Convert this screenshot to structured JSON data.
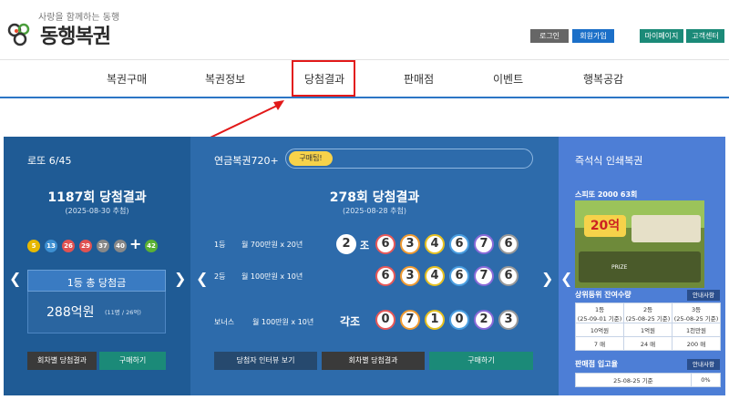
{
  "logo": {
    "slogan": "사랑을 함께하는 동행",
    "name": "동행복권"
  },
  "topbar": {
    "login": "로그인",
    "signup": "회원가입",
    "mypage": "마이페이지",
    "support": "고객센터"
  },
  "nav": [
    "복권구매",
    "복권정보",
    "당첨결과",
    "판매점",
    "이벤트",
    "행복공감"
  ],
  "lotto": {
    "title": "로또 6/45",
    "round": "1187회 당첨결과",
    "date": "(2025-08-30 추첨)",
    "numbers": [
      "5",
      "13",
      "26",
      "29",
      "37",
      "40"
    ],
    "bonus": "42",
    "plus": "+",
    "prize_label": "1등 총 당첨금",
    "prize_amount": "288억원",
    "prize_sub": "(11명 / 26억)",
    "btn_results": "회차별 당첨결과",
    "btn_buy": "구매하기"
  },
  "pension": {
    "title": "연금복권720+",
    "tip": "구매팁!",
    "round": "278회 당첨결과",
    "date": "(2025-08-28 추첨)",
    "row1_label": "1등",
    "row1_desc": "월 700만원 x 20년",
    "row1_group": "2",
    "row1_jo": "조",
    "row1_numbers": [
      "6",
      "3",
      "4",
      "6",
      "7",
      "6"
    ],
    "row2_label": "2등",
    "row2_desc": "월 100만원 x 10년",
    "row2_numbers": [
      "6",
      "3",
      "4",
      "6",
      "7",
      "6"
    ],
    "row3_label": "보너스",
    "row3_desc": "월 100만원 x 10년",
    "row3_group": "각조",
    "row3_numbers": [
      "0",
      "7",
      "1",
      "0",
      "2",
      "3"
    ],
    "btn_interview": "당첨자 인터뷰 보기",
    "btn_results": "회차별 당첨결과",
    "btn_buy": "구매하기"
  },
  "instant": {
    "title": "즉석식 인쇄복권",
    "product": "스피또 2000 63회",
    "card_amount": "20억",
    "card_prize": "PRIZE",
    "table_title": "상위등위 잔여수량",
    "guide": "안내사항",
    "headers": [
      "1등\n(25-09-01 기준)",
      "2등\n(25-08-25 기준)",
      "3등\n(25-08-25 기준)"
    ],
    "amounts": [
      "10억원",
      "1억원",
      "1천만원"
    ],
    "counts": [
      "7 매",
      "24 매",
      "200 매"
    ],
    "stock_title": "판매점 입고율",
    "stock_date": "25-08-25 기준",
    "stock_value": "0%"
  },
  "colors": {
    "accent": "#2b75c5",
    "teal": "#1b8a78",
    "navy": "#1f5b95",
    "highlight": "#e21919"
  }
}
